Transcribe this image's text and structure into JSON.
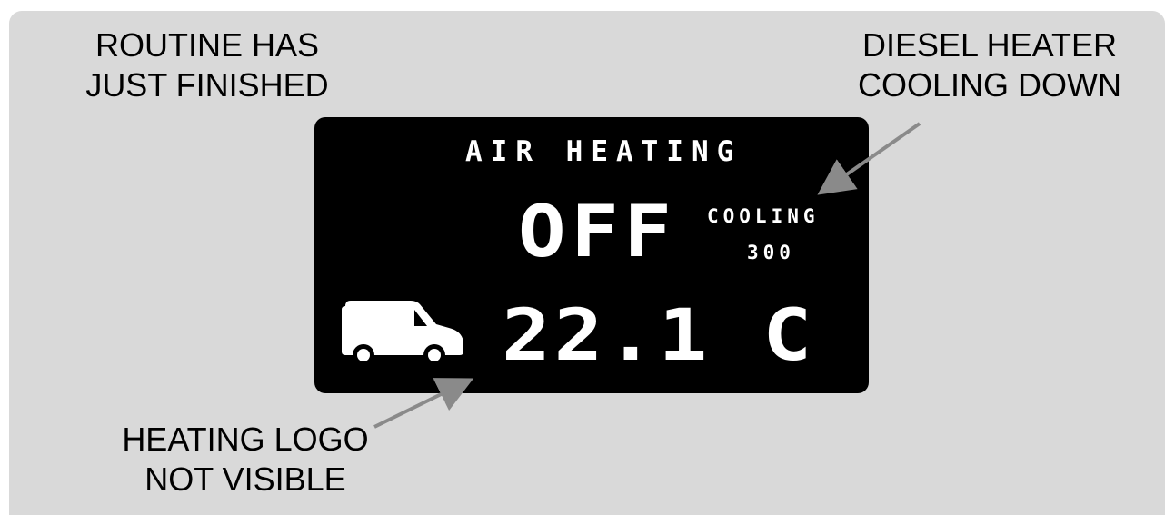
{
  "callouts": {
    "routine": {
      "line1": "ROUTINE HAS",
      "line2": "JUST FINISHED"
    },
    "cooling": {
      "line1": "DIESEL HEATER",
      "line2": "COOLING DOWN"
    },
    "logo": {
      "line1": "HEATING LOGO",
      "line2": "NOT VISIBLE"
    }
  },
  "display": {
    "title": "AIR HEATING",
    "state": "OFF",
    "cooling_label": "COOLING",
    "cooling_timer": "300",
    "temperature": "22.1 C",
    "icon": "van-icon"
  },
  "colors": {
    "background": "#d9d9d9",
    "screen": "#000000",
    "screen_text": "#ffffff",
    "arrow": "#8a8a8a"
  }
}
